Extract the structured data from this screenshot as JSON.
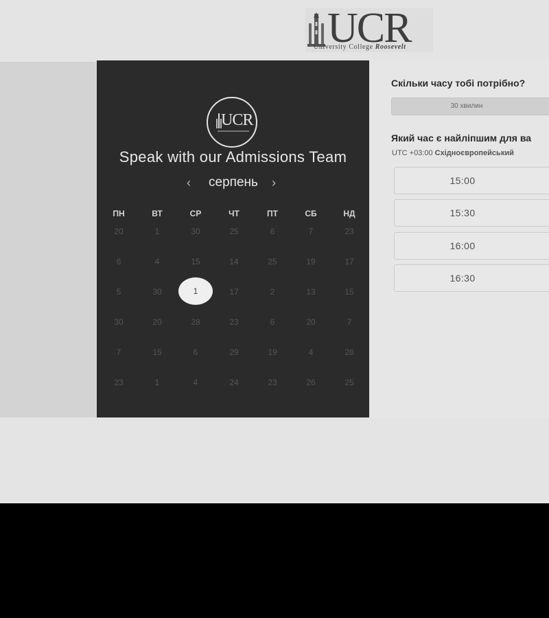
{
  "logo": {
    "letters": "UCR",
    "tagline_plain": "University College ",
    "tagline_bold": "Roosevelt"
  },
  "left_panel": {
    "circle_logo_letters": "UCR",
    "title": "Speak with our Admissions Team",
    "month": "серпень",
    "prev_icon": "chevron-left-icon",
    "next_icon": "chevron-right-icon",
    "weekdays": [
      "ПН",
      "ВТ",
      "СР",
      "ЧТ",
      "ПТ",
      "СБ",
      "НД"
    ],
    "weeks": [
      [
        "20",
        "1",
        "30",
        "25",
        "6",
        "7",
        "23"
      ],
      [
        "6",
        "4",
        "15",
        "14",
        "25",
        "19",
        "17"
      ],
      [
        "5",
        "30",
        "1",
        "17",
        "2",
        "13",
        "15"
      ],
      [
        "30",
        "20",
        "28",
        "23",
        "6",
        "20",
        "7"
      ],
      [
        "7",
        "15",
        "6",
        "29",
        "19",
        "4",
        "28"
      ],
      [
        "23",
        "1",
        "4",
        "24",
        "23",
        "26",
        "25"
      ]
    ],
    "selected_day": "1"
  },
  "right_panel": {
    "duration_question": "Скільки часу тобі потрібно?",
    "duration_value": "30 хвилин",
    "time_question": "Який час є найліпшим для ва",
    "timezone_prefix": "UTC +03:00 ",
    "timezone_name": "Східноєвропейський",
    "slots": [
      "15:00",
      "15:30",
      "16:00",
      "16:30"
    ]
  },
  "colors": {
    "panel_dark": "#2b2b2b",
    "page_bg": "#e4e4e4",
    "selected_day_bg": "#efefef"
  }
}
